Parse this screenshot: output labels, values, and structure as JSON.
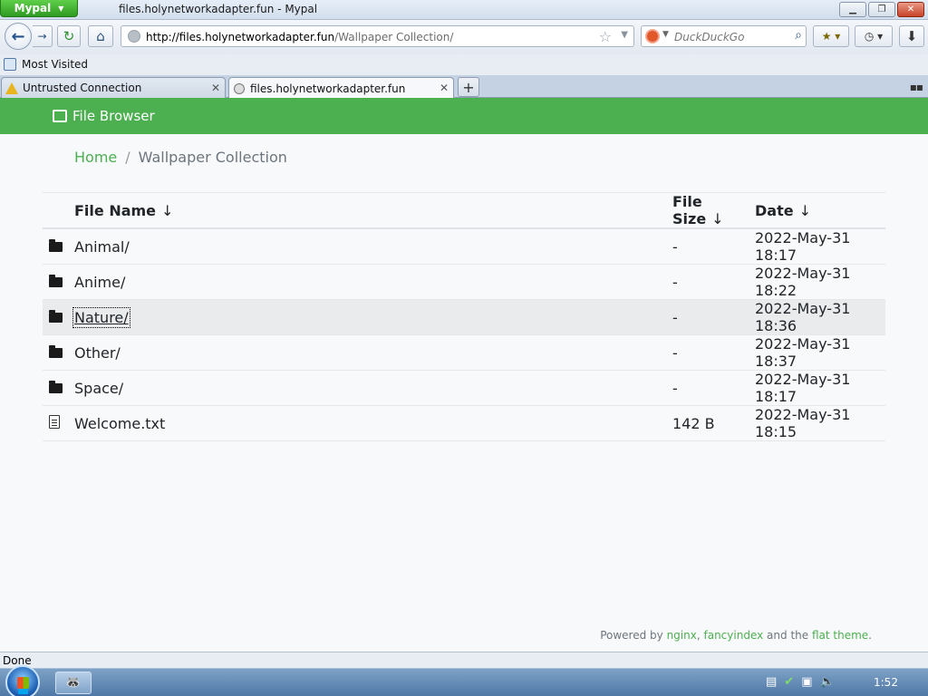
{
  "browser": {
    "app_button": "Mypal",
    "window_title": "files.holynetworkadapter.fun - Mypal",
    "url_host": "http://files.holynetworkadapter.fun",
    "url_path": "/Wallpaper Collection/",
    "search_placeholder": "DuckDuckGo",
    "bookmark_label": "Most Visited",
    "tabs": [
      {
        "label": "Untrusted Connection",
        "icon": "warning-icon"
      },
      {
        "label": "files.holynetworkadapter.fun",
        "icon": "globe-icon"
      }
    ],
    "status_text": "Done"
  },
  "page": {
    "brand": "File Browser",
    "breadcrumb": {
      "home": "Home",
      "current": "Wallpaper Collection"
    },
    "table": {
      "headers": {
        "name": "File Name",
        "size": "File Size",
        "date": "Date",
        "arrow": "↓"
      },
      "rows": [
        {
          "icon": "folder-icon",
          "name": "Animal/",
          "size": "-",
          "date": "2022-May-31 18:17"
        },
        {
          "icon": "folder-icon",
          "name": "Anime/",
          "size": "-",
          "date": "2022-May-31 18:22"
        },
        {
          "icon": "folder-icon",
          "name": "Nature/",
          "size": "-",
          "date": "2022-May-31 18:36"
        },
        {
          "icon": "folder-icon",
          "name": "Other/",
          "size": "-",
          "date": "2022-May-31 18:37"
        },
        {
          "icon": "folder-icon",
          "name": "Space/",
          "size": "-",
          "date": "2022-May-31 18:17"
        },
        {
          "icon": "document-icon",
          "name": "Welcome.txt",
          "size": "142 B",
          "date": "2022-May-31 18:15"
        }
      ]
    },
    "footer": {
      "prefix": "Powered by",
      "link1": "nginx",
      "sep": ",",
      "link2": "fancyindex",
      "mid": "and the",
      "link3": "flat theme",
      "end": "."
    }
  },
  "taskbar": {
    "clock": "1:52"
  },
  "colors": {
    "header_green": "#4caf50",
    "link_green": "#4caf50"
  }
}
